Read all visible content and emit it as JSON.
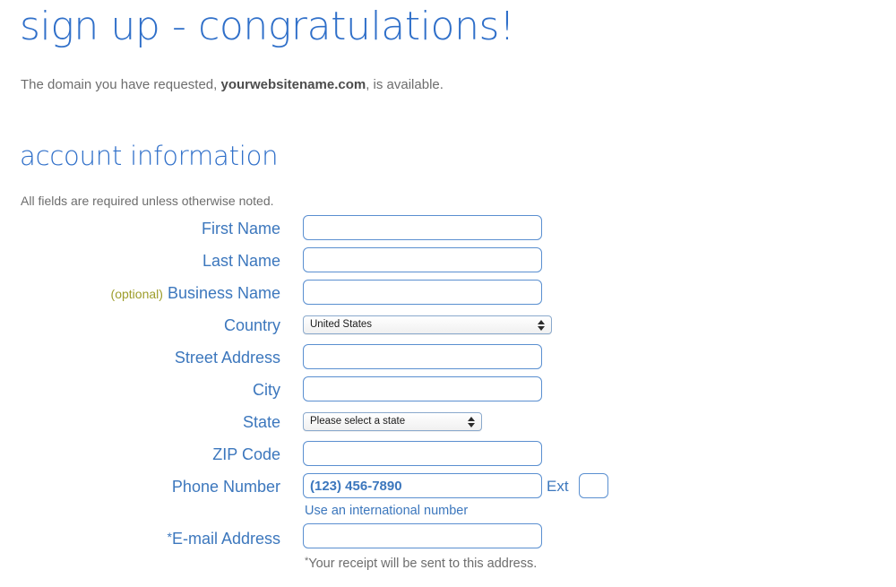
{
  "header": {
    "title": "sign up - congratulations!",
    "lede_before": "The domain you have requested, ",
    "lede_domain": "yourwebsitename.com",
    "lede_after": ", is available."
  },
  "section": {
    "title": "account information",
    "required_note": "All fields are required unless otherwise noted."
  },
  "fields": {
    "first_name": {
      "label": "First Name",
      "value": "",
      "placeholder": ""
    },
    "last_name": {
      "label": "Last Name",
      "value": "",
      "placeholder": ""
    },
    "business_name": {
      "optional_tag": "(optional)",
      "label": "Business Name",
      "value": "",
      "placeholder": ""
    },
    "country": {
      "label": "Country",
      "selected": "United States"
    },
    "street_address": {
      "label": "Street Address",
      "value": "",
      "placeholder": ""
    },
    "city": {
      "label": "City",
      "value": "",
      "placeholder": ""
    },
    "state": {
      "label": "State",
      "selected": "Please select a state"
    },
    "zip_code": {
      "label": "ZIP Code",
      "value": "",
      "placeholder": ""
    },
    "phone": {
      "label": "Phone Number",
      "placeholder": "(123) 456-7890",
      "value": "",
      "ext_label": "Ext",
      "ext_value": "",
      "helper": "Use an international number"
    },
    "email": {
      "star": "*",
      "label": "E-mail Address",
      "value": "",
      "placeholder": "",
      "helper_star": "*",
      "helper": "Your receipt will be sent to this address."
    }
  },
  "colors": {
    "heading_blue": "#2f6fc9",
    "label_blue": "#3c77bd",
    "optional_olive": "#9d9d2b",
    "body_gray": "#6d6d6d",
    "input_border": "#5a8fd0"
  }
}
